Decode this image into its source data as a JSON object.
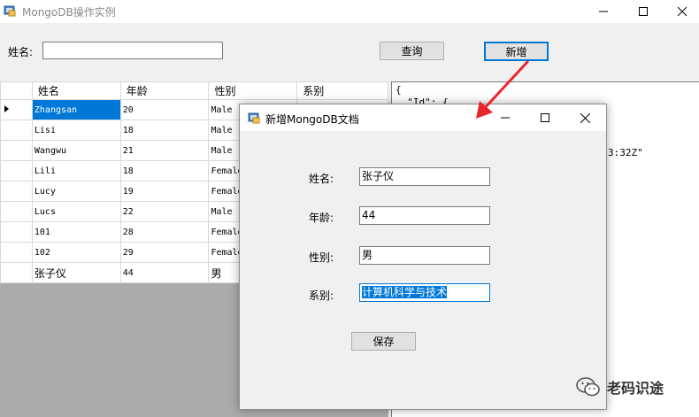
{
  "main_window": {
    "title": "MongoDB操作实例"
  },
  "search": {
    "label": "姓名:",
    "value": "",
    "query_button": "查询",
    "add_button": "新增"
  },
  "grid": {
    "headers": [
      "姓名",
      "年龄",
      "性别",
      "系别"
    ],
    "rows": [
      {
        "name": "Zhangsan",
        "age": "20",
        "gender": "Male",
        "dept": ""
      },
      {
        "name": "Lisi",
        "age": "18",
        "gender": "Male",
        "dept": ""
      },
      {
        "name": "Wangwu",
        "age": "21",
        "gender": "Male",
        "dept": ""
      },
      {
        "name": "Lili",
        "age": "18",
        "gender": "Female",
        "dept": ""
      },
      {
        "name": "Lucy",
        "age": "19",
        "gender": "Female",
        "dept": ""
      },
      {
        "name": "Lucs",
        "age": "22",
        "gender": "Male",
        "dept": ""
      },
      {
        "name": "101",
        "age": "28",
        "gender": "Female",
        "dept": ""
      },
      {
        "name": "102",
        "age": "29",
        "gender": "Female",
        "dept": ""
      },
      {
        "name": "张子仪",
        "age": "44",
        "gender": "男",
        "dept": ""
      }
    ],
    "selected_row": 0
  },
  "json_view": {
    "lines": [
      "{",
      "  \"Id\": {",
      "3:32Z\""
    ]
  },
  "dialog": {
    "title": "新增MongoDB文档",
    "fields": {
      "name": {
        "label": "姓名:",
        "value": "张子仪"
      },
      "age": {
        "label": "年龄:",
        "value": "44"
      },
      "gender": {
        "label": "性别:",
        "value": "男"
      },
      "dept": {
        "label": "系别:",
        "value": "计算机科学与技术"
      }
    },
    "save_button": "保存"
  },
  "watermark": {
    "text": "老码识途"
  },
  "colors": {
    "accent": "#0078d7",
    "arrow": "#e8262b"
  },
  "icons": [
    "app-icon",
    "minimize-icon",
    "maximize-icon",
    "close-icon",
    "row-pointer-icon",
    "wechat-icon"
  ]
}
